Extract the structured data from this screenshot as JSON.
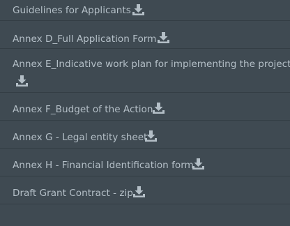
{
  "documents": [
    {
      "label": "Guidelines for Applicants",
      "icon": "download-icon"
    },
    {
      "label": "Annex D_Full Application Form",
      "icon": "download-icon"
    },
    {
      "label": "Annex E_Indicative work plan for implementing the project",
      "icon": "download-icon"
    },
    {
      "label": "Annex F_Budget of the Action",
      "icon": "download-icon"
    },
    {
      "label": "Annex G - Legal entity sheet",
      "icon": "download-icon"
    },
    {
      "label": "Annex H - Financial Identification form",
      "icon": "download-icon"
    },
    {
      "label": "Draft Grant Contract - zip",
      "icon": "download-icon"
    }
  ],
  "colors": {
    "background": "#3f4a52",
    "link_text": "#b4bfc7",
    "icon": "#b4bfc7",
    "divider": "#343e45"
  }
}
